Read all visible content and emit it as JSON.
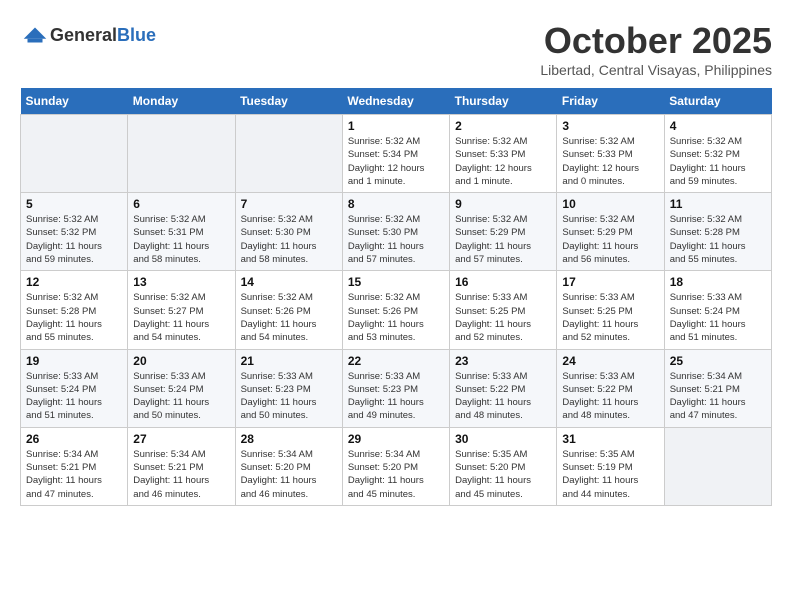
{
  "header": {
    "logo_general": "General",
    "logo_blue": "Blue",
    "month": "October 2025",
    "location": "Libertad, Central Visayas, Philippines"
  },
  "weekdays": [
    "Sunday",
    "Monday",
    "Tuesday",
    "Wednesday",
    "Thursday",
    "Friday",
    "Saturday"
  ],
  "weeks": [
    [
      {
        "day": "",
        "info": ""
      },
      {
        "day": "",
        "info": ""
      },
      {
        "day": "",
        "info": ""
      },
      {
        "day": "1",
        "info": "Sunrise: 5:32 AM\nSunset: 5:34 PM\nDaylight: 12 hours\nand 1 minute."
      },
      {
        "day": "2",
        "info": "Sunrise: 5:32 AM\nSunset: 5:33 PM\nDaylight: 12 hours\nand 1 minute."
      },
      {
        "day": "3",
        "info": "Sunrise: 5:32 AM\nSunset: 5:33 PM\nDaylight: 12 hours\nand 0 minutes."
      },
      {
        "day": "4",
        "info": "Sunrise: 5:32 AM\nSunset: 5:32 PM\nDaylight: 11 hours\nand 59 minutes."
      }
    ],
    [
      {
        "day": "5",
        "info": "Sunrise: 5:32 AM\nSunset: 5:32 PM\nDaylight: 11 hours\nand 59 minutes."
      },
      {
        "day": "6",
        "info": "Sunrise: 5:32 AM\nSunset: 5:31 PM\nDaylight: 11 hours\nand 58 minutes."
      },
      {
        "day": "7",
        "info": "Sunrise: 5:32 AM\nSunset: 5:30 PM\nDaylight: 11 hours\nand 58 minutes."
      },
      {
        "day": "8",
        "info": "Sunrise: 5:32 AM\nSunset: 5:30 PM\nDaylight: 11 hours\nand 57 minutes."
      },
      {
        "day": "9",
        "info": "Sunrise: 5:32 AM\nSunset: 5:29 PM\nDaylight: 11 hours\nand 57 minutes."
      },
      {
        "day": "10",
        "info": "Sunrise: 5:32 AM\nSunset: 5:29 PM\nDaylight: 11 hours\nand 56 minutes."
      },
      {
        "day": "11",
        "info": "Sunrise: 5:32 AM\nSunset: 5:28 PM\nDaylight: 11 hours\nand 55 minutes."
      }
    ],
    [
      {
        "day": "12",
        "info": "Sunrise: 5:32 AM\nSunset: 5:28 PM\nDaylight: 11 hours\nand 55 minutes."
      },
      {
        "day": "13",
        "info": "Sunrise: 5:32 AM\nSunset: 5:27 PM\nDaylight: 11 hours\nand 54 minutes."
      },
      {
        "day": "14",
        "info": "Sunrise: 5:32 AM\nSunset: 5:26 PM\nDaylight: 11 hours\nand 54 minutes."
      },
      {
        "day": "15",
        "info": "Sunrise: 5:32 AM\nSunset: 5:26 PM\nDaylight: 11 hours\nand 53 minutes."
      },
      {
        "day": "16",
        "info": "Sunrise: 5:33 AM\nSunset: 5:25 PM\nDaylight: 11 hours\nand 52 minutes."
      },
      {
        "day": "17",
        "info": "Sunrise: 5:33 AM\nSunset: 5:25 PM\nDaylight: 11 hours\nand 52 minutes."
      },
      {
        "day": "18",
        "info": "Sunrise: 5:33 AM\nSunset: 5:24 PM\nDaylight: 11 hours\nand 51 minutes."
      }
    ],
    [
      {
        "day": "19",
        "info": "Sunrise: 5:33 AM\nSunset: 5:24 PM\nDaylight: 11 hours\nand 51 minutes."
      },
      {
        "day": "20",
        "info": "Sunrise: 5:33 AM\nSunset: 5:24 PM\nDaylight: 11 hours\nand 50 minutes."
      },
      {
        "day": "21",
        "info": "Sunrise: 5:33 AM\nSunset: 5:23 PM\nDaylight: 11 hours\nand 50 minutes."
      },
      {
        "day": "22",
        "info": "Sunrise: 5:33 AM\nSunset: 5:23 PM\nDaylight: 11 hours\nand 49 minutes."
      },
      {
        "day": "23",
        "info": "Sunrise: 5:33 AM\nSunset: 5:22 PM\nDaylight: 11 hours\nand 48 minutes."
      },
      {
        "day": "24",
        "info": "Sunrise: 5:33 AM\nSunset: 5:22 PM\nDaylight: 11 hours\nand 48 minutes."
      },
      {
        "day": "25",
        "info": "Sunrise: 5:34 AM\nSunset: 5:21 PM\nDaylight: 11 hours\nand 47 minutes."
      }
    ],
    [
      {
        "day": "26",
        "info": "Sunrise: 5:34 AM\nSunset: 5:21 PM\nDaylight: 11 hours\nand 47 minutes."
      },
      {
        "day": "27",
        "info": "Sunrise: 5:34 AM\nSunset: 5:21 PM\nDaylight: 11 hours\nand 46 minutes."
      },
      {
        "day": "28",
        "info": "Sunrise: 5:34 AM\nSunset: 5:20 PM\nDaylight: 11 hours\nand 46 minutes."
      },
      {
        "day": "29",
        "info": "Sunrise: 5:34 AM\nSunset: 5:20 PM\nDaylight: 11 hours\nand 45 minutes."
      },
      {
        "day": "30",
        "info": "Sunrise: 5:35 AM\nSunset: 5:20 PM\nDaylight: 11 hours\nand 45 minutes."
      },
      {
        "day": "31",
        "info": "Sunrise: 5:35 AM\nSunset: 5:19 PM\nDaylight: 11 hours\nand 44 minutes."
      },
      {
        "day": "",
        "info": ""
      }
    ]
  ]
}
